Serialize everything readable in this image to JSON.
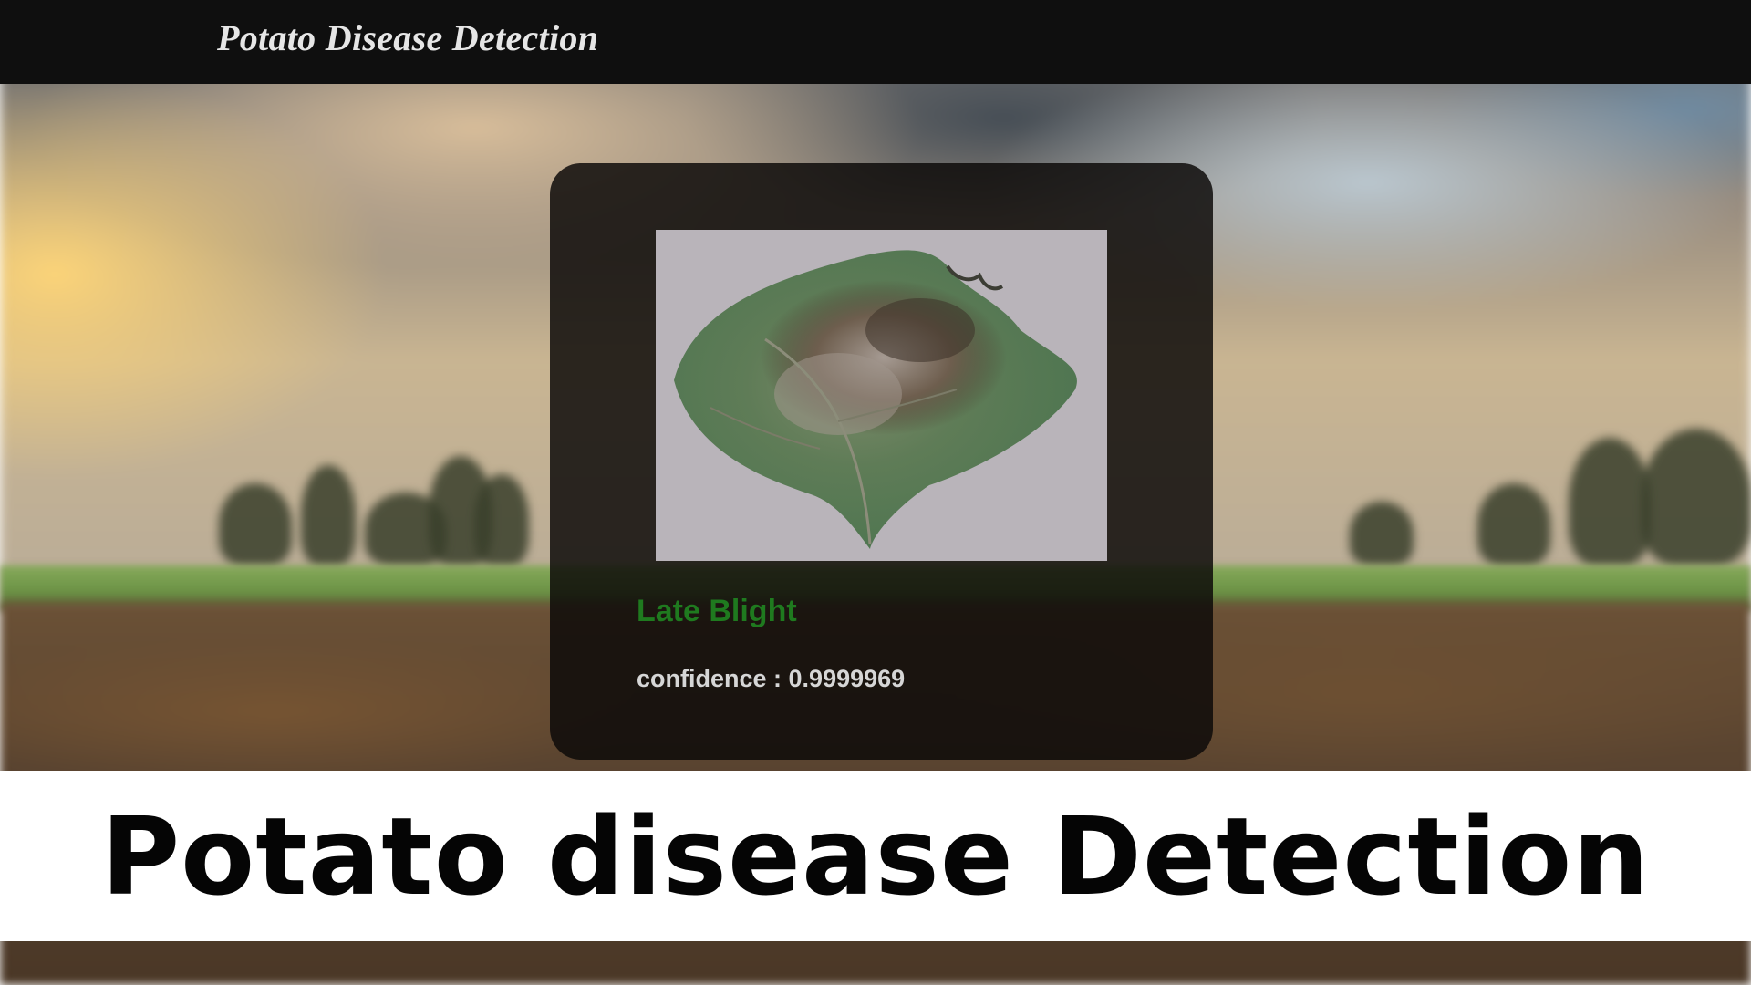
{
  "navbar": {
    "brand": "Potato Disease Detection"
  },
  "result": {
    "image_subject": "potato-leaf-late-blight",
    "label": "Late Blight",
    "label_color": "#1f7a1f",
    "confidence_label": "confidence : ",
    "confidence_value": "0.9999969"
  },
  "banner": {
    "title": "Potato disease Detection"
  },
  "colors": {
    "navbar_bg": "#0f0f0f",
    "card_bg": "rgba(12,10,8,0.84)",
    "banner_bg": "#ffffff"
  }
}
